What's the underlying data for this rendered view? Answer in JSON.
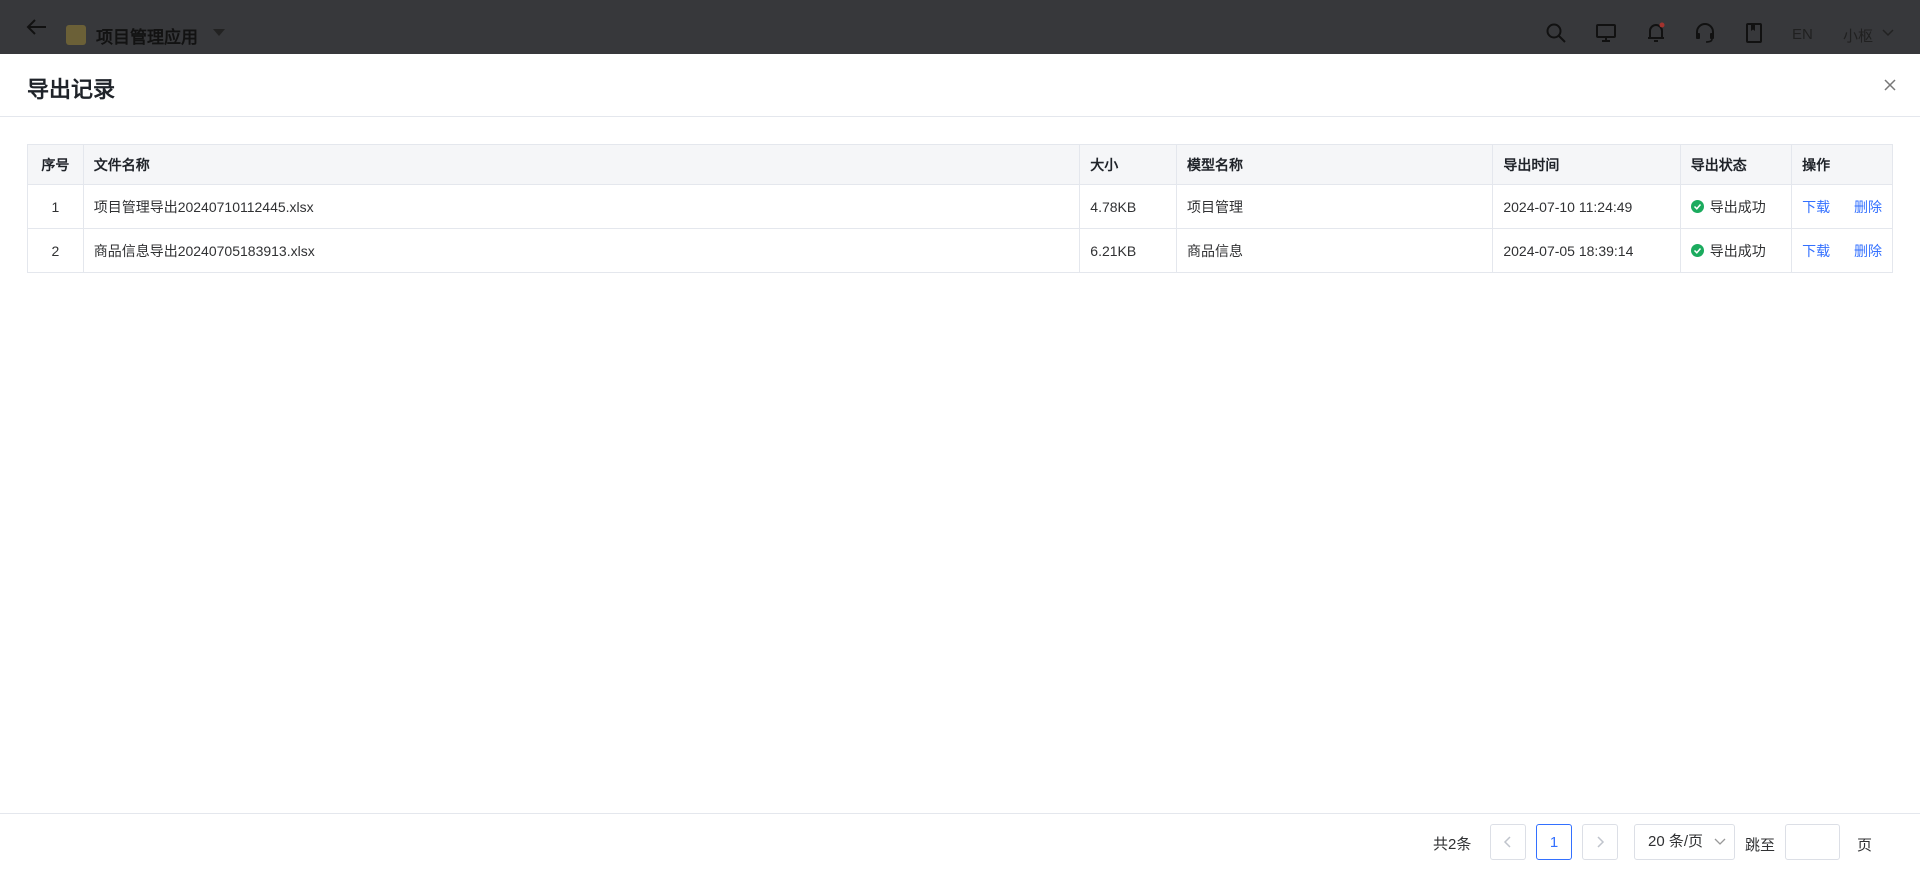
{
  "topbar": {
    "app_title": "项目管理应用",
    "lang": "EN",
    "user": "小枢",
    "icons": [
      "arrow-left-icon",
      "search-icon",
      "monitor-icon",
      "bell-icon",
      "headset-icon",
      "book-icon",
      "chevron-down-icon"
    ]
  },
  "drawer": {
    "title": "导出记录"
  },
  "table": {
    "headers": {
      "index": "序号",
      "file": "文件名称",
      "size": "大小",
      "model": "模型名称",
      "time": "导出时间",
      "status": "导出状态",
      "action": "操作"
    },
    "rows": [
      {
        "index": "1",
        "file": "项目管理导出20240710112445.xlsx",
        "size": "4.78KB",
        "model": "项目管理",
        "time": "2024-07-10 11:24:49",
        "status": "导出成功",
        "download": "下载",
        "delete": "删除"
      },
      {
        "index": "2",
        "file": "商品信息导出20240705183913.xlsx",
        "size": "6.21KB",
        "model": "商品信息",
        "time": "2024-07-05 18:39:14",
        "status": "导出成功",
        "download": "下载",
        "delete": "删除"
      }
    ]
  },
  "pagination": {
    "total": "共2条",
    "prev": "<",
    "current": "1",
    "next": ">",
    "page_size": "20 条/页",
    "jump_label": "跳至",
    "jump_value": "",
    "page_label": "页"
  },
  "colors": {
    "accent": "#3370ff",
    "success": "#1bab5e",
    "topbar": "#37383b"
  }
}
